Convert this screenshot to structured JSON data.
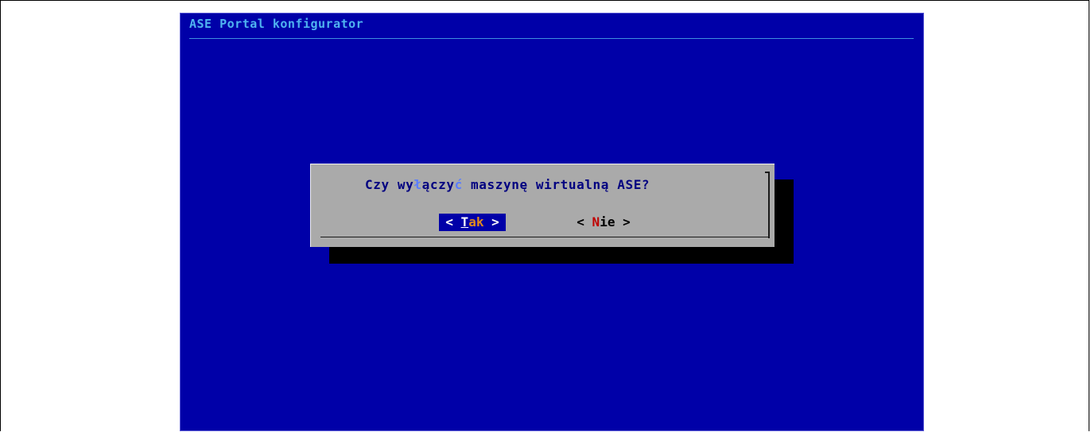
{
  "window": {
    "backtitle": "ASE Portal konfigurator"
  },
  "dialog": {
    "prompt_before": "Czy wy",
    "prompt_hl1": "ł",
    "prompt_mid": "ączy",
    "prompt_hl2": "ć",
    "prompt_after": " maszynę wirtualną ASE?",
    "yes_button": {
      "open": "< ",
      "hotkey": "T",
      "rest": "ak",
      "close": " >"
    },
    "no_button": {
      "open": "< ",
      "hotkey": "N",
      "rest": "ie",
      "close": " >"
    }
  },
  "colors": {
    "screen_background": "#0000a8",
    "dialog_background": "#aaaaaa",
    "backtitle_text": "#4fb3f0",
    "prompt_text": "#000080",
    "selected_button_background": "#0000a8",
    "hotkey_red": "#c00000",
    "selected_rest_text": "#e08a1e"
  }
}
